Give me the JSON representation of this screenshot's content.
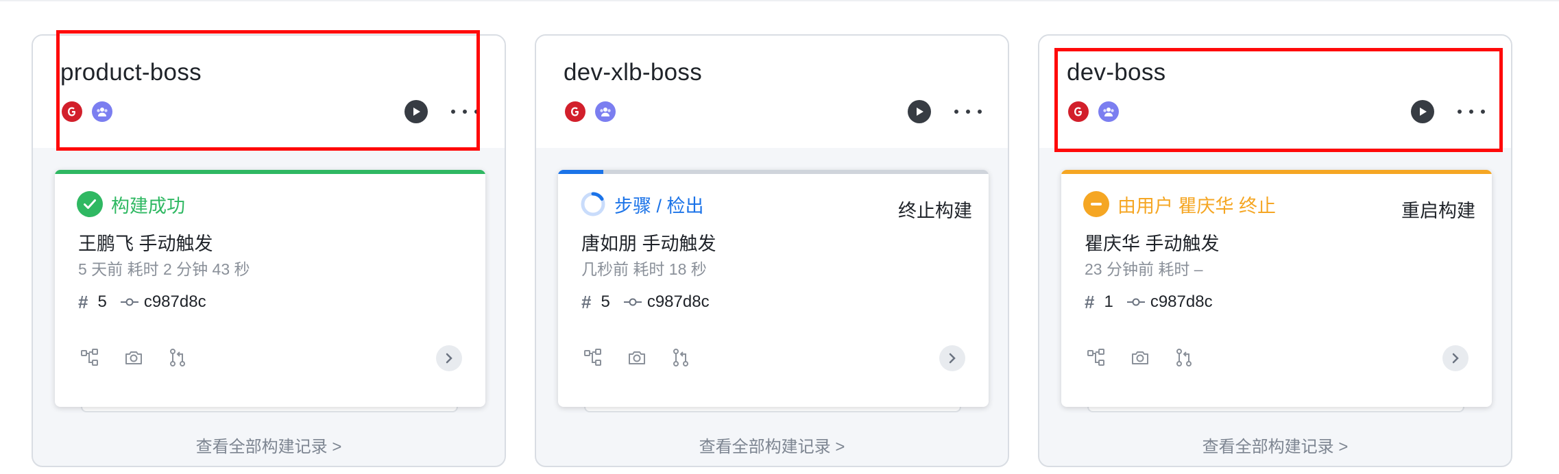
{
  "colors": {
    "success": "#2fb862",
    "running": "#1b73e8",
    "stopped": "#f5a623",
    "highlight": "#ff0a0a"
  },
  "pipelines": [
    {
      "name": "product-boss",
      "status": {
        "kind": "success",
        "text": "构建成功",
        "action": ""
      },
      "trigger": "王鹏飞 手动触发",
      "meta": "5 天前 耗时 2 分钟 43 秒",
      "build_number": "5",
      "commit": "c987d8c",
      "view_all": "查看全部构建记录 >",
      "highlighted": true
    },
    {
      "name": "dev-xlb-boss",
      "status": {
        "kind": "running",
        "text": "步骤 / 检出",
        "action": "终止构建"
      },
      "trigger": "唐如朋 手动触发",
      "meta": "几秒前 耗时 18 秒",
      "build_number": "5",
      "commit": "c987d8c",
      "view_all": "查看全部构建记录 >",
      "highlighted": false
    },
    {
      "name": "dev-boss",
      "status": {
        "kind": "stopped",
        "text": "由用户 瞿庆华 终止",
        "action": "重启构建"
      },
      "trigger": "瞿庆华 手动触发",
      "meta": "23 分钟前 耗时 –",
      "build_number": "1",
      "commit": "c987d8c",
      "view_all": "查看全部构建记录 >",
      "highlighted": true
    }
  ],
  "icons": [
    "gitee-icon",
    "team-icon",
    "run-icon",
    "more-icon",
    "check-circle-icon",
    "spinner-icon",
    "stop-icon",
    "hash-icon",
    "commit-icon",
    "pipeline-graph-icon",
    "snapshot-icon",
    "pull-request-icon",
    "chevron-right-icon"
  ]
}
